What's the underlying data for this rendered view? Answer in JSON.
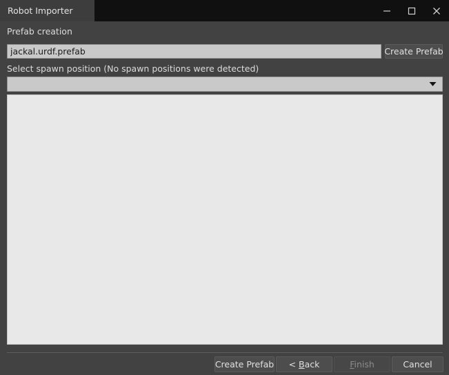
{
  "window": {
    "tab_title": "Robot Importer",
    "controls": {
      "minimize": "minimize-icon",
      "maximize": "maximize-icon",
      "close": "close-icon"
    }
  },
  "form": {
    "section_label": "Prefab creation",
    "prefab_name_value": "jackal.urdf.prefab",
    "prefab_name_placeholder": "",
    "create_prefab_top_label": "Create Prefab",
    "spawn_label": "Select spawn position (No spawn positions were detected)",
    "spawn_selected_value": "",
    "spawn_options": [],
    "dropdown_icon": "chevron-down-icon"
  },
  "preview": {
    "content": ""
  },
  "footer": {
    "create_prefab_label": "Create Prefab",
    "back_label_prefix": "< ",
    "back_label_mnemonic": "B",
    "back_label_suffix": "ack",
    "finish_label_mnemonic": "F",
    "finish_label_suffix": "inish",
    "finish_enabled": "false",
    "cancel_label": "Cancel"
  },
  "colors": {
    "window_background": "#424242",
    "titlebar_background": "#101010",
    "tab_background": "#3d3d3d",
    "field_background": "#c9c9c9",
    "panel_background": "#e8e8e8",
    "button_background": "#4d4d4d",
    "disabled_text": "#8c8c8c"
  }
}
